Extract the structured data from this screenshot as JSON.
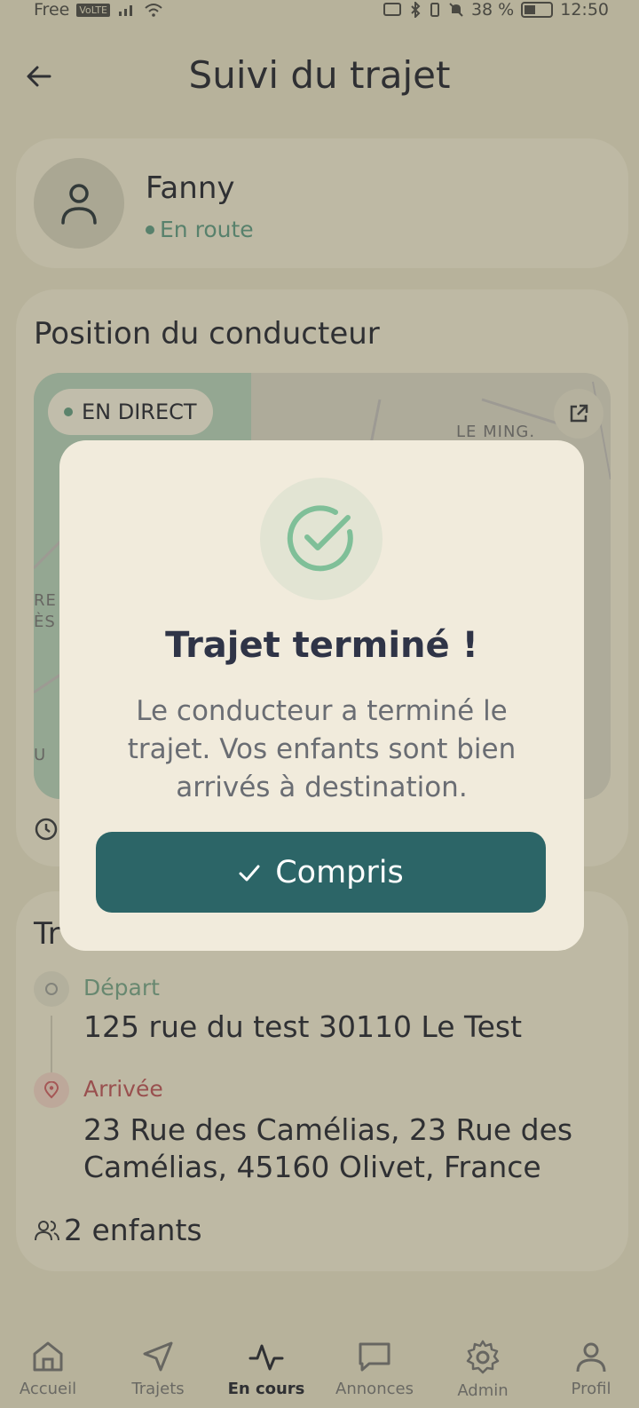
{
  "status_bar": {
    "carrier": "Free",
    "network": "VoLTE",
    "battery": "38 %",
    "battery_level": 0.38,
    "time": "12:50"
  },
  "header": {
    "title": "Suivi du trajet"
  },
  "driver": {
    "name": "Fanny",
    "status": "En route",
    "status_color": "#5a8a74"
  },
  "position": {
    "title": "Position du conducteur",
    "live_label": "EN DIRECT",
    "map_labels": [
      "LE MING.",
      "RE",
      "ÈS",
      "U"
    ]
  },
  "trip": {
    "title_partial": "Tr",
    "departure": {
      "label": "Départ",
      "address": "125 rue du test 30110 Le Test"
    },
    "arrival": {
      "label": "Arrivée",
      "address_line1": "23 Rue des Camélias, 23 Rue des",
      "address_line2": "Camélias, 45160 Olivet, France"
    },
    "kids": "2 enfants"
  },
  "modal": {
    "title": "Trajet terminé !",
    "text_line1": "Le conducteur a terminé le",
    "text_line2": "trajet. Vos enfants sont bien",
    "text_line3": "arrivés à destination.",
    "button_label": "Compris",
    "accent": "#2c6567"
  },
  "nav": {
    "items": [
      {
        "label": "Accueil",
        "icon": "home-icon"
      },
      {
        "label": "Trajets",
        "icon": "navigation-icon"
      },
      {
        "label": "En cours",
        "icon": "activity-icon"
      },
      {
        "label": "Annonces",
        "icon": "message-icon"
      },
      {
        "label": "Admin",
        "icon": "gear-icon"
      },
      {
        "label": "Profil",
        "icon": "user-icon"
      }
    ]
  }
}
